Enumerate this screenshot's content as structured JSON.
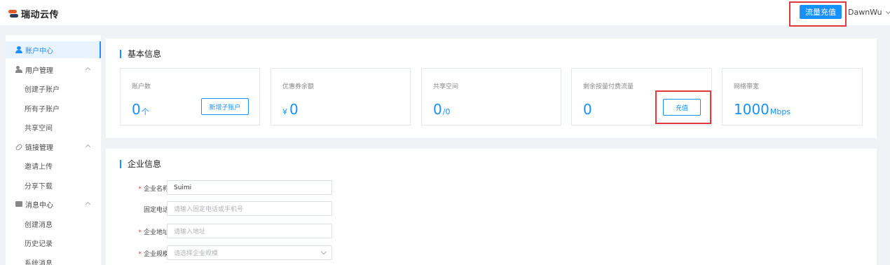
{
  "header": {
    "brand": "瑞动云传",
    "recharge_label": "流量充值",
    "username": "DawnWu"
  },
  "sidebar": {
    "items": [
      {
        "label": "账户中心",
        "icon": "user-icon",
        "active": true
      },
      {
        "label": "用户管理",
        "icon": "users-icon",
        "expandable": true
      },
      {
        "label": "创建子账户"
      },
      {
        "label": "所有子账户"
      },
      {
        "label": "共享空间"
      },
      {
        "label": "链接管理",
        "icon": "link-icon",
        "expandable": true
      },
      {
        "label": "邀请上传"
      },
      {
        "label": "分享下载"
      },
      {
        "label": "消息中心",
        "icon": "message-icon",
        "expandable": true
      },
      {
        "label": "创建消息"
      },
      {
        "label": "历史记录"
      },
      {
        "label": "系统消息"
      }
    ]
  },
  "basic_info": {
    "title": "基本信息",
    "cards": [
      {
        "label": "账户数",
        "value": "0",
        "unit": "个",
        "button": "新增子账户"
      },
      {
        "label": "优惠券余额",
        "prefix": "¥",
        "value": "0"
      },
      {
        "label": "共享空间",
        "value": "0",
        "unit": "/0"
      },
      {
        "label": "剩余按量付费流量",
        "value": "0",
        "button": "充值"
      },
      {
        "label": "网络带宽",
        "value": "1000",
        "unit": "Mbps"
      }
    ]
  },
  "company_info": {
    "title": "企业信息",
    "fields": [
      {
        "label": "企业名称",
        "required": true,
        "value": "Suimi"
      },
      {
        "label": "固定电话",
        "required": false,
        "placeholder": "请输入固定电话或手机号"
      },
      {
        "label": "企业地址",
        "required": true,
        "placeholder": "请输入地址"
      },
      {
        "label": "企业规模",
        "required": true,
        "placeholder": "请选择企业规模",
        "type": "select"
      }
    ]
  },
  "colors": {
    "accent": "#1890ff",
    "highlight_box": "#e03a3a",
    "background": "#f0f2f5"
  }
}
